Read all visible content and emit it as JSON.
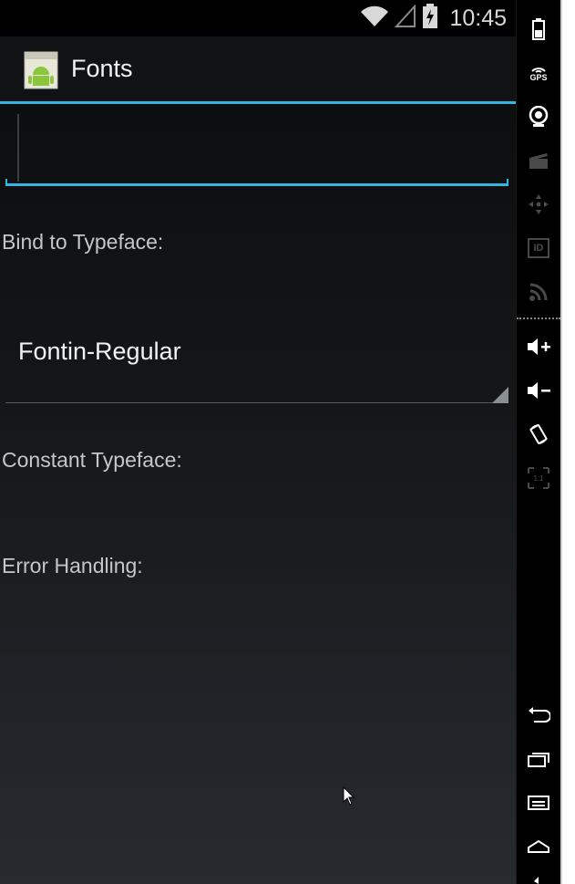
{
  "status_bar": {
    "time": "10:45",
    "icons": [
      "wifi-icon",
      "signal-icon",
      "battery-charging-icon"
    ]
  },
  "action_bar": {
    "app_icon": "android-app-icon",
    "title": "Fonts"
  },
  "edit_text": {
    "value": ""
  },
  "labels": {
    "bind_to_typeface": "Bind to Typeface:",
    "constant_typeface": "Constant Typeface:",
    "error_handling": "Error Handling:"
  },
  "spinner": {
    "selected": "Fontin-Regular"
  },
  "emulator_sidebar": {
    "gps_label": "GPS",
    "id_label": "ID",
    "zoom_label": "1:1",
    "buttons": [
      "battery-icon",
      "gps-icon",
      "camera-icon",
      "video-icon",
      "dpad-icon",
      "id-icon",
      "rss-icon",
      "volume-up-icon",
      "volume-down-icon",
      "rotate-icon",
      "scale-icon",
      "back-icon",
      "recent-apps-icon",
      "menu-icon",
      "home-icon"
    ]
  },
  "colors": {
    "accent": "#33b5e5",
    "label_text": "#c6c6c6",
    "title_text": "#f2f2f2"
  }
}
